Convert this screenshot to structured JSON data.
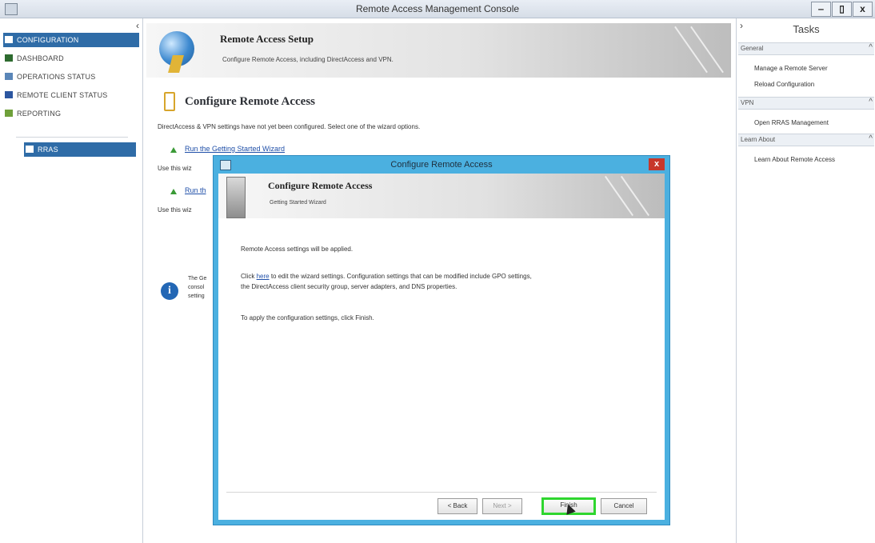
{
  "window": {
    "title": "Remote Access Management Console",
    "controls": {
      "minimize": "‒",
      "maximize": "▯",
      "close": "x"
    }
  },
  "nav": {
    "collapse": "‹",
    "items": [
      {
        "label": "CONFIGURATION",
        "icon": "configuration-icon",
        "color": "#3c6fae",
        "active": true
      },
      {
        "label": "DASHBOARD",
        "icon": "dashboard-icon",
        "color": "#2e6b2f"
      },
      {
        "label": "OPERATIONS STATUS",
        "icon": "operations-status-icon",
        "color": "#5a86b8"
      },
      {
        "label": "REMOTE CLIENT STATUS",
        "icon": "remote-client-status-icon",
        "color": "#2c56a0"
      },
      {
        "label": "REPORTING",
        "icon": "reporting-icon",
        "color": "#6fa03a"
      }
    ],
    "server": {
      "label": "RRAS",
      "icon": "server-icon"
    }
  },
  "main": {
    "banner": {
      "title": "Remote Access Setup",
      "subtitle": "Configure Remote Access, including DirectAccess and VPN."
    },
    "heading": "Configure Remote Access",
    "description": "DirectAccess & VPN settings have not yet been configured. Select one of the wizard options.",
    "link1": "Run the Getting Started Wizard",
    "use1": "Use this wiz",
    "link2": "Run th",
    "use2": "Use this wiz",
    "info_lines": [
      "The Ge",
      "consol",
      "setting"
    ]
  },
  "tasks": {
    "expand": "›",
    "title": "Tasks",
    "groups": [
      {
        "label": "General",
        "collapse": "^",
        "items": [
          "Manage a Remote Server",
          "Reload Configuration"
        ]
      },
      {
        "label": "VPN",
        "collapse": "^",
        "items": [
          "Open RRAS Management"
        ]
      },
      {
        "label": "Learn About",
        "collapse": "^",
        "items": [
          "Learn About Remote Access"
        ]
      }
    ]
  },
  "dialog": {
    "title": "Configure Remote Access",
    "close": "x",
    "header_title": "Configure Remote Access",
    "header_subtitle": "Getting Started Wizard",
    "line1": "Remote Access settings will be applied.",
    "click_prefix": "Click",
    "here": "here",
    "click_rest": "to edit the wizard settings. Configuration settings that can be modified include GPO settings,",
    "click_line2": "the DirectAccess client security group, server adapters, and DNS properties.",
    "apply": "To apply the configuration settings, click Finish.",
    "buttons": {
      "back": "< Back",
      "next": "Next >",
      "finish": "Finish",
      "cancel": "Cancel"
    },
    "highlight_color": "#2fd62f"
  }
}
